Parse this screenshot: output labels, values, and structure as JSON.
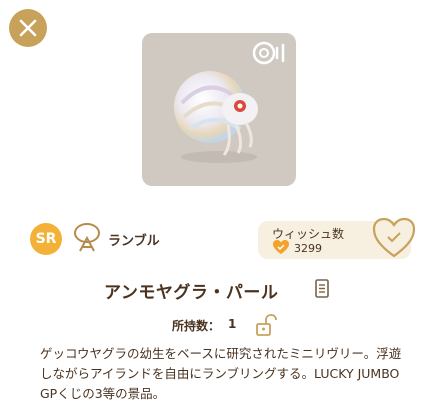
{
  "item": {
    "rarity": "SR",
    "type_label": "ランブル",
    "name": "アンモヤグラ・パール",
    "owned_label": "所持数：",
    "owned_count": "1",
    "description": "ゲッコウヤグラの幼生をベースに研究されたミニリヴリー。浮遊しながらアイランドを自由にランブリングする。LUCKY JUMBO GPくじの3等の景品。"
  },
  "wish": {
    "label": "ウィッシュ数",
    "count": "3299"
  },
  "icons": {
    "close": "close-icon",
    "sound": "sound-icon",
    "type": "rumble-icon",
    "heart": "heart-icon",
    "doc": "document-icon",
    "lock": "unlock-icon"
  },
  "colors": {
    "accent": "#c8a25a",
    "rarity": "#f3b237",
    "text": "#4a3320",
    "wish_bg": "#f7efe0"
  }
}
